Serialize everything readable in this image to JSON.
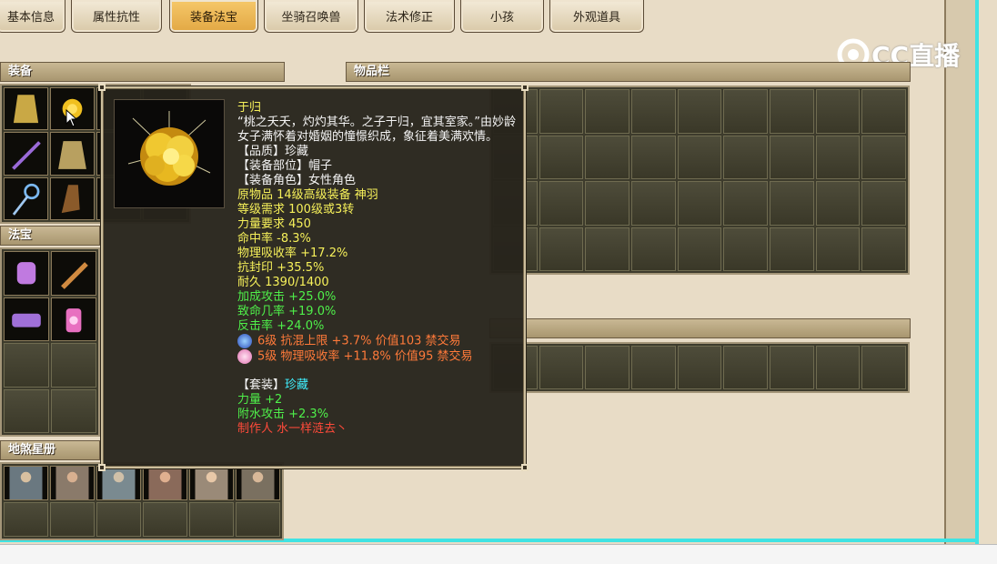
{
  "tabs": [
    {
      "label": "基本信息",
      "active": false
    },
    {
      "label": "属性抗性",
      "active": false
    },
    {
      "label": "装备法宝",
      "active": true
    },
    {
      "label": "坐骑召唤兽",
      "active": false
    },
    {
      "label": "法术修正",
      "active": false
    },
    {
      "label": "小孩",
      "active": false
    },
    {
      "label": "外观道具",
      "active": false
    }
  ],
  "sections": {
    "equipment": "装备",
    "treasure": "法宝",
    "stars": "地煞星册",
    "inventory": "物品栏"
  },
  "watermark": "CC直播",
  "tooltip": {
    "name": "于归",
    "description": "“桃之夭夭，灼灼其华。之子于归，宜其室家。”由妙龄女子满怀着对婚姻的憧憬织成，象征着美满欢情。",
    "quality": "【品质】珍藏",
    "slot": "【装备部位】帽子",
    "role": "【装备角色】女性角色",
    "origin": "原物品 14级高级装备 神羽",
    "level_req": "等级需求 100级或3转",
    "str_req": "力量要求 450",
    "hit": "命中率 -8.3%",
    "phys_absorb": "物理吸收率 +17.2%",
    "seal_res": "抗封印 +35.5%",
    "durability": "耐久 1390/1400",
    "bonus_atk": "加成攻击 +25.0%",
    "crit": "致命几率 +19.0%",
    "counter": "反击率 +24.0%",
    "gem1": "6级 抗混上限 +3.7% 价值103 禁交易",
    "gem2": "5级 物理吸收率 +11.8% 价值95 禁交易",
    "set_label": "【套装】",
    "set_name": "珍藏",
    "set_str": "力量 +2",
    "set_water": "附水攻击 +2.3%",
    "maker": "制作人 水一样涟去丶"
  },
  "colors": {
    "active_tab": "#e2a844",
    "tooltip_name": "#f6f05a",
    "stat_green": "#4ff04a",
    "gem_orange": "#ff7a3a",
    "maker_red": "#ff4a3a",
    "set_cyan": "#3ff0ff"
  }
}
